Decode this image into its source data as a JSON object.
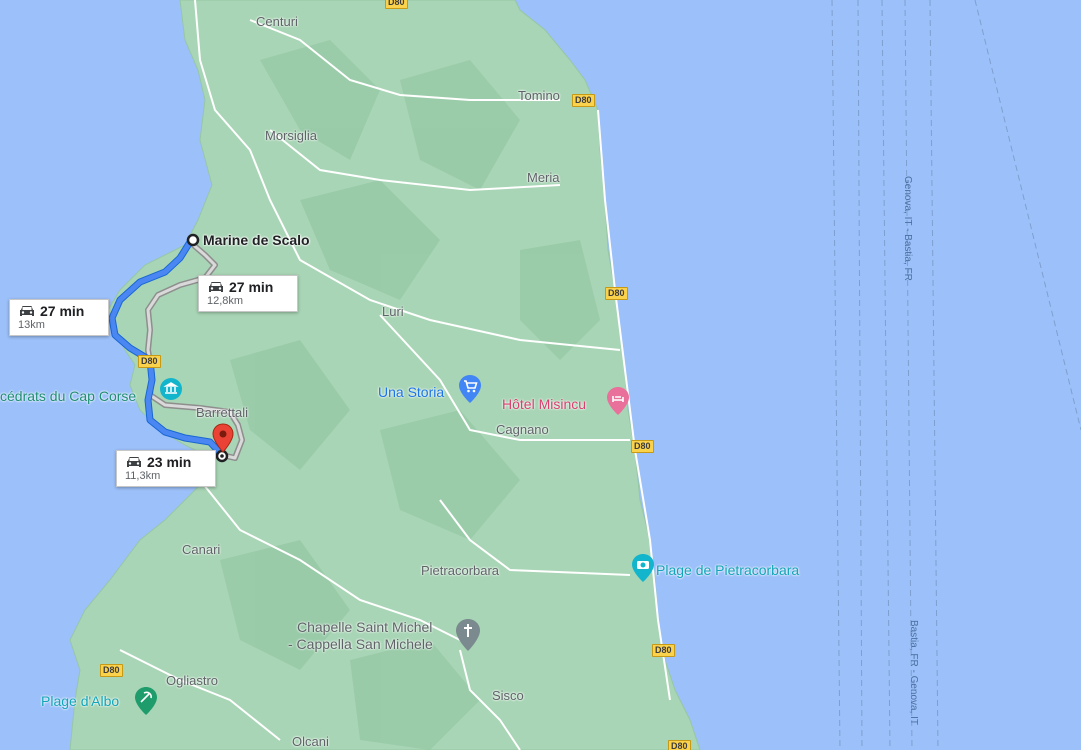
{
  "colors": {
    "sea": "#9cc0f9",
    "land": "#a6d3b4",
    "route_primary": "#4a87f2",
    "route_alt": "#9e9e9e",
    "pin_red": "#ea4335"
  },
  "route": {
    "origin": "Marine de Scalo",
    "options": [
      {
        "time": "27 min",
        "distance": "13km"
      },
      {
        "time": "27 min",
        "distance": "12,8km"
      },
      {
        "time": "23 min",
        "distance": "11,3km"
      }
    ]
  },
  "towns": {
    "centuri": "Centuri",
    "tomino": "Tomino",
    "morsiglia": "Morsiglia",
    "meria": "Meria",
    "luri": "Luri",
    "barrettali": "Barrettali",
    "cagnano": "Cagnano",
    "canari": "Canari",
    "pietracorbara": "Pietracorbara",
    "ogliastro": "Ogliastro",
    "sisco": "Sisco",
    "olcani": "Olcani"
  },
  "pois": {
    "cedrats": "cédrats du Cap Corse",
    "una_storia": "Una Storia",
    "hotel": "Hôtel Misincu",
    "plage_pietra": "Plage de Pietracorbara",
    "chapelle_1": "Chapelle Saint Michel",
    "chapelle_2": "- Cappella San Michele",
    "plage_albo": "Plage d'Albo"
  },
  "roads": {
    "d80": "D80"
  },
  "ferries": {
    "genova_bastia": "Genova, IT - Bastia, FR",
    "bastia_genova": "Bastia, FR - Genova, IT"
  },
  "icons": [
    "car-icon",
    "shopping-cart-icon",
    "hotel-icon",
    "camera-icon",
    "church-cross-icon",
    "beach-icon",
    "museum-icon",
    "red-destination-pin-icon"
  ]
}
